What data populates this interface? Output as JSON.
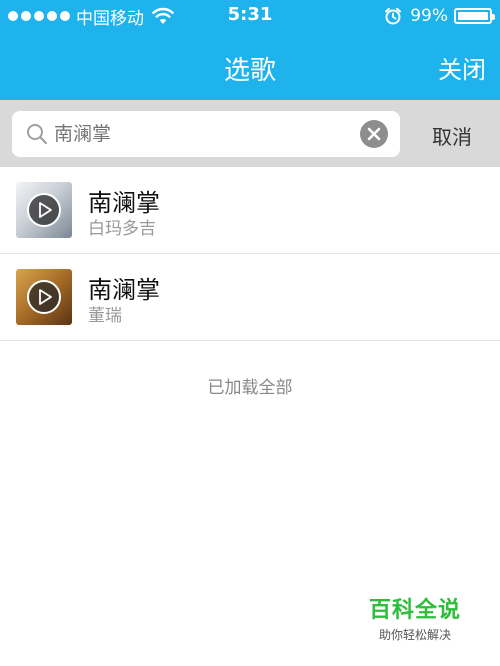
{
  "status_bar": {
    "carrier": "中国移动",
    "time": "5:31",
    "battery_percent": "99%",
    "battery_level": 0.99,
    "icons": [
      "signal-dots",
      "wifi-icon",
      "alarm-icon",
      "battery-icon"
    ]
  },
  "nav": {
    "title": "选歌",
    "close_label": "关闭"
  },
  "search": {
    "value": "",
    "placeholder": "南澜掌",
    "cancel_label": "取消",
    "icons": [
      "search-icon",
      "clear-icon"
    ]
  },
  "songs": [
    {
      "title": "南澜掌",
      "artist": "白玛多吉"
    },
    {
      "title": "南澜掌",
      "artist": "董瑞"
    }
  ],
  "footer": {
    "loaded_all": "已加载全部"
  },
  "watermark": {
    "title": "百科全说",
    "subtitle": "助你轻松解决"
  },
  "colors": {
    "nav_blue": "#1fb3ee",
    "search_bg": "#d9d9d9",
    "watermark_green": "#2dbd3a"
  }
}
